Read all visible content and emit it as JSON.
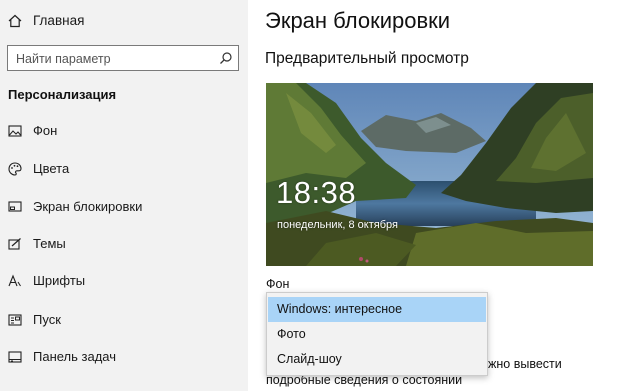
{
  "sidebar": {
    "home_label": "Главная",
    "search_placeholder": "Найти параметр",
    "section_title": "Персонализация",
    "items": [
      {
        "label": "Фон"
      },
      {
        "label": "Цвета"
      },
      {
        "label": "Экран блокировки"
      },
      {
        "label": "Темы"
      },
      {
        "label": "Шрифты"
      },
      {
        "label": "Пуск"
      },
      {
        "label": "Панель задач"
      }
    ]
  },
  "main": {
    "title": "Экран блокировки",
    "preview_heading": "Предварительный просмотр",
    "preview": {
      "time": "18:38",
      "date": "понедельник, 8 октября"
    },
    "background_label": "Фон",
    "background_dropdown": {
      "selected": "Windows: интересное",
      "options": [
        "Windows: интересное",
        "Фото",
        "Слайд-шоу"
      ]
    },
    "partial_text_1": "жно вывести",
    "partial_text_2": "подробные сведения о состоянии"
  }
}
